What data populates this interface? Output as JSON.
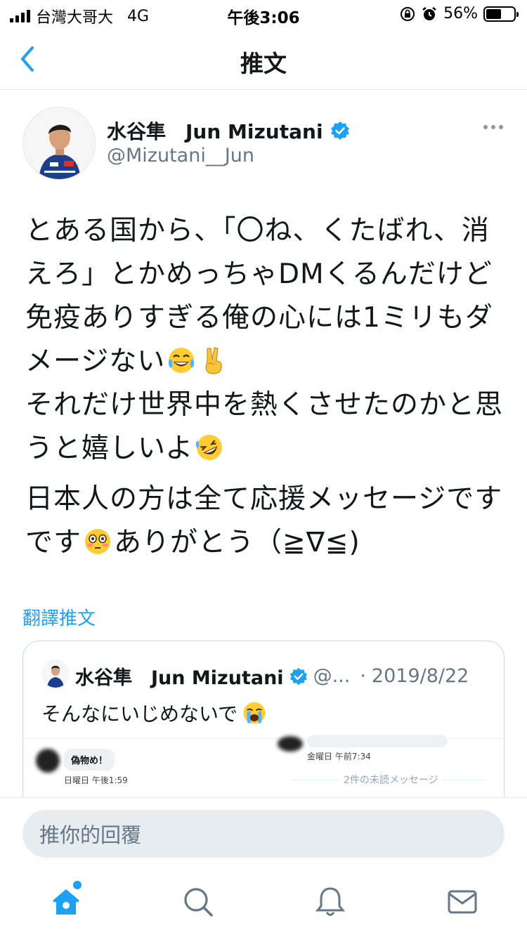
{
  "status_bar": {
    "carrier": "台灣大哥大",
    "network": "4G",
    "time": "午後3:06",
    "battery_percent": "56%",
    "battery_level": 0.56
  },
  "nav": {
    "title": "推文",
    "back_icon": "chevron-left-icon"
  },
  "tweet": {
    "display_name": "水谷隼　Jun Mizutani",
    "handle": "@Mizutani__Jun",
    "verified": true,
    "body_paragraphs": [
      [
        "とある国から、「〇ね、くたばれ、消えろ」とかめっちゃDMくるんだけど免疫ありすぎる俺の心には1ミリもダメージない",
        "{tears-of-joy-emoji}",
        "{victory-hand-emoji}",
        "それだけ世界中を熱くさせたのかと思うと嬉しいよ",
        "{rolling-on-floor-laughing-emoji}"
      ],
      [
        "日本人の方は全て応援メッセージです",
        "{flushed-face-emoji}",
        "ありがとう（≧∇≦)"
      ]
    ],
    "body": {
      "p1_a": "とある国から、「〇ね、くたばれ、消えろ」とかめっちゃDMくるんだけど免疫ありすぎる俺の心には1ミリもダメージない",
      "p1_b": "それだけ世界中を熱くさせたのかと思うと嬉しいよ",
      "p2_a": "日本人の方は全て応援メッセージです",
      "p2_b": "ありがとう（≧∇≦)"
    },
    "translate_label": "翻譯推文"
  },
  "quoted_tweet": {
    "display_name": "水谷隼　Jun Mizutani",
    "handle": "@...",
    "separator": "·",
    "date": "2019/8/22",
    "text": "そんなにいじめないで",
    "text_emoji": "loudly-crying-face-emoji",
    "image": {
      "bubble_left": "偽物め！",
      "time_left": "日曜日 午後1:59",
      "time_right": "金曜日 午前7:34",
      "unread": "2件の未読メッセージ"
    }
  },
  "reply": {
    "placeholder": "推你的回覆"
  },
  "tabs": [
    {
      "icon": "home-icon",
      "active": true,
      "badge": true
    },
    {
      "icon": "search-icon",
      "active": false
    },
    {
      "icon": "bell-icon",
      "active": false
    },
    {
      "icon": "mail-icon",
      "active": false
    }
  ],
  "colors": {
    "accent": "#1da1f2",
    "text": "#14171a",
    "muted": "#657786",
    "divider": "#e1e8ed"
  }
}
